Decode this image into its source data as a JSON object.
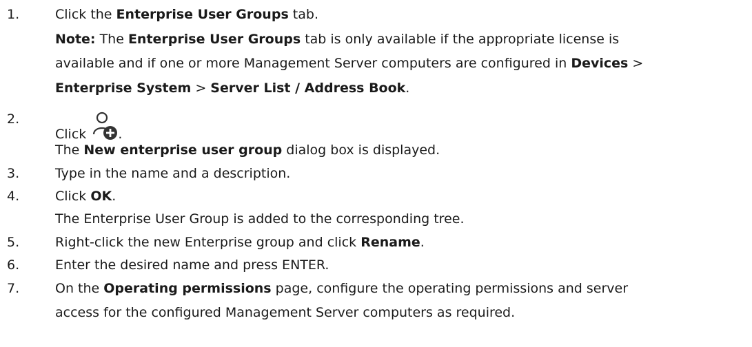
{
  "steps": [
    {
      "num": "1.",
      "text_a": "Click the ",
      "bold_a": "Enterprise User Groups",
      "text_b": " tab."
    },
    {
      "num": "2.",
      "click_label": "Click",
      "period": ".",
      "icon": "add-user-group-icon",
      "result_a": "The ",
      "result_bold": "New enterprise user group",
      "result_b": " dialog box is displayed."
    },
    {
      "num": "3.",
      "text": "Type in the name and a description."
    },
    {
      "num": "4.",
      "text_a": "Click ",
      "bold_a": "OK",
      "text_b": ".",
      "result": "The Enterprise User Group is added to the corresponding tree."
    },
    {
      "num": "5.",
      "text_a": "Right-click the new Enterprise group and click ",
      "bold_a": "Rename",
      "text_b": "."
    },
    {
      "num": "6.",
      "text": "Enter the desired name and press ENTER."
    },
    {
      "num": "7.",
      "text_a": "On the ",
      "bold_a": "Operating permissions",
      "text_b": " page, configure the operating permissions and server",
      "text_c": "access for the configured Management Server computers as required."
    }
  ],
  "note": {
    "label": "Note:",
    "t1": " The ",
    "b1": "Enterprise User Groups",
    "t2": " tab is only available if the appropriate license is",
    "t3": "available and if one or more Management Server computers are configured in ",
    "b2": "Devices",
    "sep1": " >",
    "b3": "Enterprise System",
    "sep2": " > ",
    "b4": "Server List / Address Book",
    "t4": "."
  }
}
